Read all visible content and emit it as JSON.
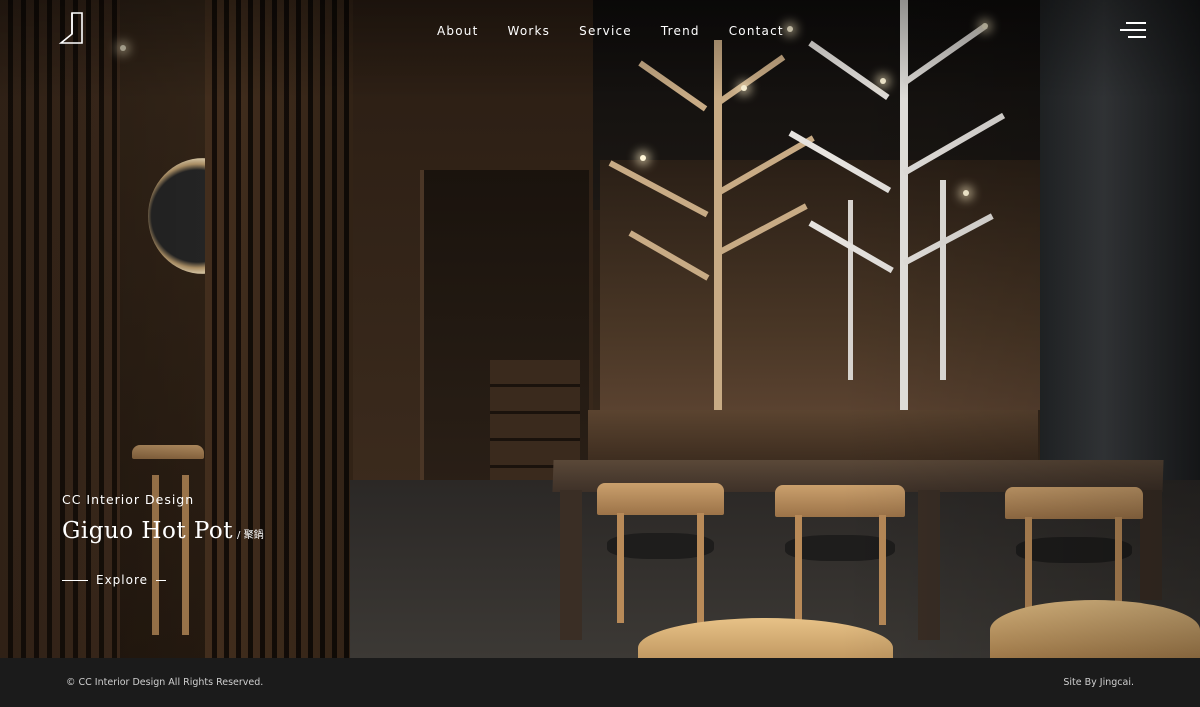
{
  "brand": {
    "logo_icon": "cc-logo-icon"
  },
  "nav": {
    "items": [
      {
        "label": "About"
      },
      {
        "label": "Works"
      },
      {
        "label": "Service"
      },
      {
        "label": "Trend"
      },
      {
        "label": "Contact"
      }
    ],
    "menu_icon": "hamburger-menu-icon"
  },
  "hero": {
    "kicker": "CC Interior Design",
    "title": "Giguo Hot Pot",
    "subtitle": "/ 聚鍋",
    "explore_label": "Explore",
    "image_subject": "Restaurant interior with wooden slat walls, tree-shaped light sculptures, and dining tables with wooden chairs"
  },
  "footer": {
    "copyright": "© CC Interior Design All Rights Reserved.",
    "credit": "Site By Jingcai."
  },
  "colors": {
    "footer_bg": "#1b1b1b",
    "text": "#ffffff",
    "footer_text": "#cfcfcf"
  }
}
